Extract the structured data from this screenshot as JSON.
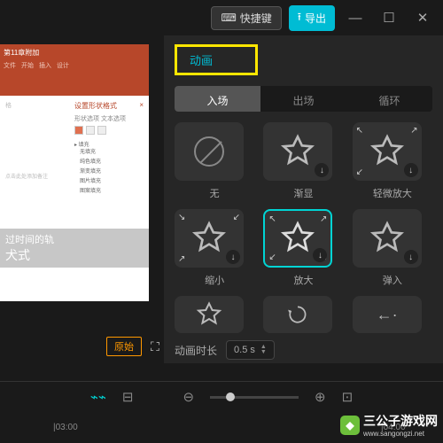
{
  "titlebar": {
    "shortcut_label": "快捷键",
    "export_label": "导出"
  },
  "preview": {
    "ppt_title": "第11章附加",
    "pane_title": "设置形状格式",
    "pane_sub": "形状选项  文本选项",
    "overlay_line1": "过时间的轨",
    "overlay_line2": "犬式",
    "original_btn": "原始"
  },
  "panel": {
    "tab_active": "动画",
    "subtabs": [
      "入场",
      "出场",
      "循环"
    ],
    "items_row1": [
      {
        "label": "无",
        "kind": "none"
      },
      {
        "label": "渐显",
        "kind": "star"
      },
      {
        "label": "轻微放大",
        "kind": "star-out"
      }
    ],
    "items_row2": [
      {
        "label": "缩小",
        "kind": "star-in"
      },
      {
        "label": "放大",
        "kind": "star-out",
        "selected": true
      },
      {
        "label": "弹入",
        "kind": "star"
      }
    ],
    "items_row3": [
      {
        "kind": "star"
      },
      {
        "kind": "spin"
      },
      {
        "kind": "arrow-left"
      }
    ],
    "duration_label": "动画时长",
    "duration_value": "0.5 s"
  },
  "timeline": {
    "ticks": [
      "03:00",
      "04:00"
    ]
  },
  "watermark": "三公子游戏网",
  "watermark_url": "www.sangongzi.net"
}
